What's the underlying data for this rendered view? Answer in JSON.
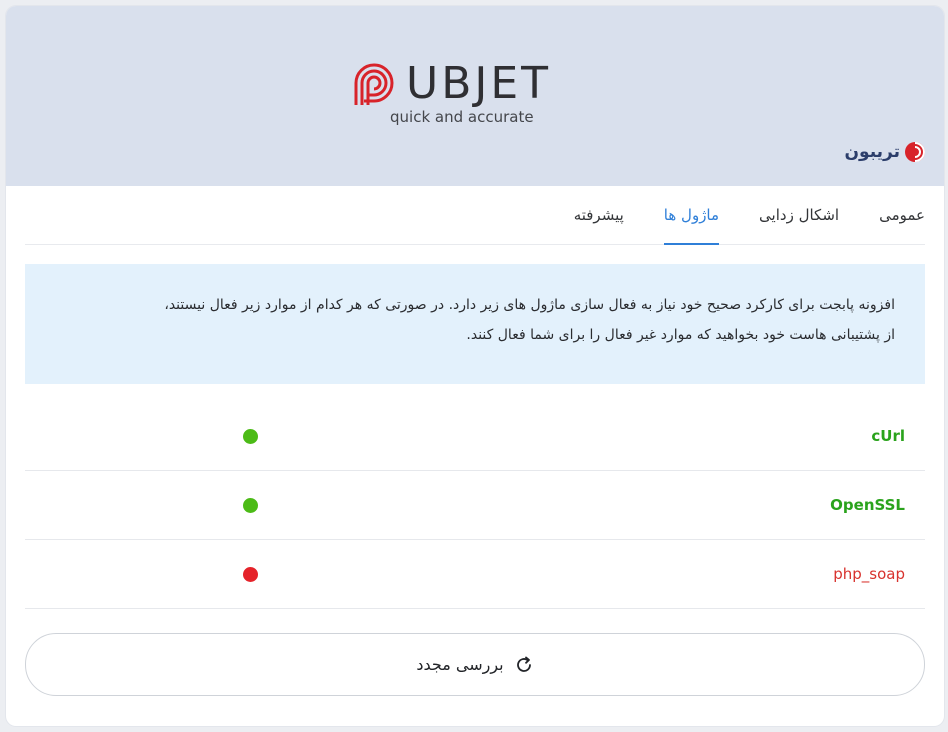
{
  "header": {
    "logo_word": "UBJET",
    "tagline": "quick and accurate",
    "brand_name": "تریبون",
    "logo_color": "#d8232a"
  },
  "tabs": [
    {
      "label": "عمومی",
      "active": false
    },
    {
      "label": "اشکال زدایی",
      "active": false
    },
    {
      "label": "ماژول ها",
      "active": true
    },
    {
      "label": "پیشرفته",
      "active": false
    }
  ],
  "info": {
    "line1": "افزونه پابجت برای کارکرد صحیح خود نیاز به فعال سازی ماژول های زیر دارد. در صورتی که هر کدام از موارد زیر فعال نیستند،",
    "line2": "از پشتیبانی هاست خود بخواهید که موارد غیر فعال را برای شما فعال کنند."
  },
  "modules": [
    {
      "name": "cUrl",
      "status": "enabled",
      "color": "#4cbb17"
    },
    {
      "name": "OpenSSL",
      "status": "enabled",
      "color": "#4cbb17"
    },
    {
      "name": "php_soap",
      "status": "disabled",
      "color": "#e5232a"
    }
  ],
  "recheck_button": {
    "label": "بررسی مجدد",
    "icon": "refresh-icon"
  },
  "colors": {
    "accent": "#2f7fd8",
    "header_bg": "#d9e0ed",
    "info_bg": "#e3f1fc",
    "ok": "#2aa31c",
    "bad": "#d8332e"
  }
}
